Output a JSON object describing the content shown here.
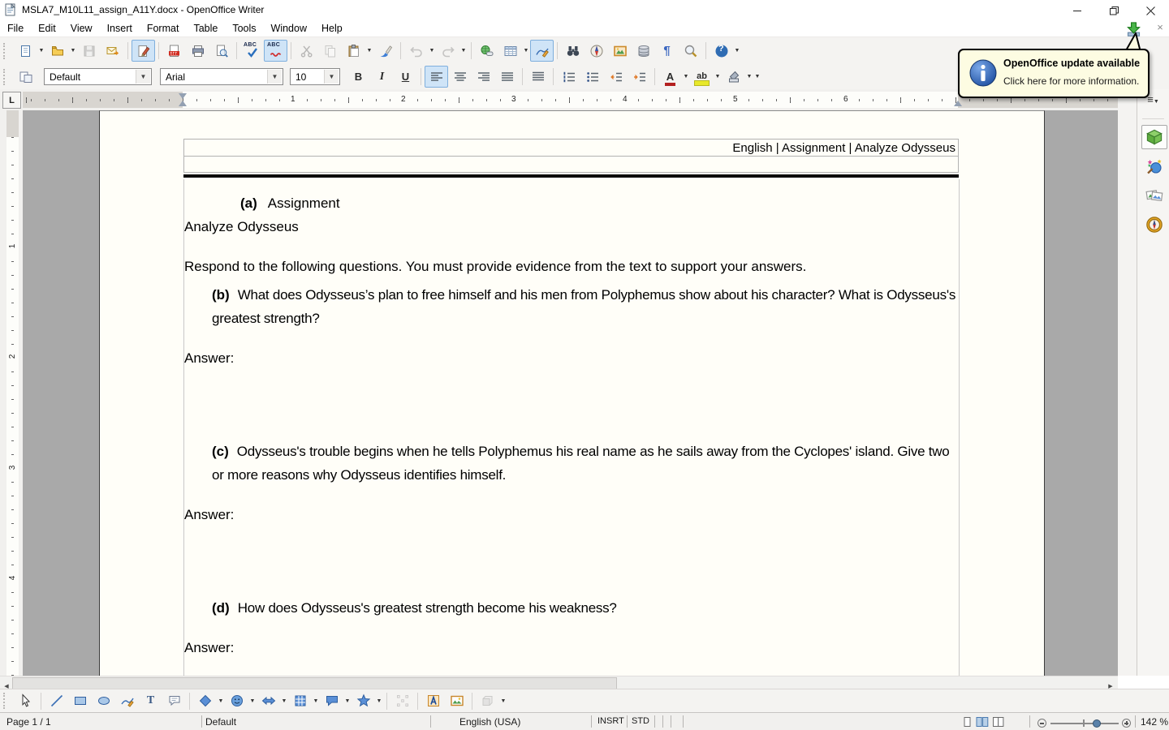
{
  "window": {
    "title": "MSLA7_M10L11_assign_A11Y.docx - OpenOffice Writer",
    "controls": [
      "minimize",
      "restore",
      "close"
    ]
  },
  "menu": [
    "File",
    "Edit",
    "View",
    "Insert",
    "Format",
    "Table",
    "Tools",
    "Window",
    "Help"
  ],
  "toolbar_standard": {
    "buttons": [
      "new-document",
      "open",
      "save",
      "email-document",
      "edit-file",
      "export-pdf",
      "print",
      "page-preview",
      "spellcheck",
      "auto-spellcheck",
      "cut",
      "copy",
      "paste",
      "format-paintbrush",
      "undo",
      "redo",
      "hyperlink",
      "insert-table",
      "show-draw-functions",
      "find-replace",
      "navigator",
      "gallery",
      "data-sources",
      "nonprinting-characters",
      "zoom",
      "help"
    ],
    "abc_label": "ABC",
    "pilcrow": "¶",
    "help_glyph": "?"
  },
  "toolbar_formatting": {
    "paragraph_style": "Default",
    "font_name": "Arial",
    "font_size": "10",
    "bold": "B",
    "italic": "I",
    "underline": "U",
    "font_color_glyph": "A",
    "highlight_glyph": "ab",
    "buttons": [
      "styles-and-formatting",
      "bold",
      "italic",
      "underline",
      "align-left",
      "align-center",
      "align-right",
      "justified",
      "line-spacing",
      "numbered-list",
      "bullet-list",
      "decrease-indent",
      "increase-indent",
      "font-color",
      "highlighting",
      "background-color"
    ]
  },
  "notification": {
    "title": "OpenOffice update available",
    "message": "Click here for more information."
  },
  "ruler": {
    "tab_type": "L",
    "h_numbers": [
      "1",
      "2",
      "3",
      "4",
      "5",
      "6"
    ],
    "v_numbers": [
      "1",
      "2",
      "3",
      "4"
    ]
  },
  "document": {
    "header_right": "English | Assignment | Analyze Odysseus",
    "a_label": "(a)",
    "a_text": "Assignment",
    "p_analyze": "Analyze Odysseus",
    "p_respond": "Respond to the following questions. You must provide evidence from the text to support your answers.",
    "b_label": "(b)",
    "b_text": "What does Odysseus’s plan to free himself and his men from Polyphemus show about his character? What is Odysseus's greatest strength?",
    "c_label": "(c)",
    "c_text": "Odysseus's trouble begins when he tells Polyphemus his real name as he sails away from the Cyclopes' island. Give two or more reasons why Odysseus identifies himself.",
    "d_label": "(d)",
    "d_text": "How does Odysseus's greatest strength become his weakness?",
    "answer": "Answer:"
  },
  "drawing_toolbar": {
    "buttons": [
      "select",
      "line",
      "rectangle",
      "ellipse",
      "freeform-line",
      "text",
      "callout-frame",
      "basic-shapes",
      "symbol-shapes",
      "block-arrows",
      "flowchart",
      "callouts",
      "stars",
      "points",
      "fontwork-gallery",
      "from-file",
      "extrusion"
    ],
    "text_glyph": "T"
  },
  "status_bar": {
    "page": "Page 1 / 1",
    "page_style": "Default",
    "language": "English (USA)",
    "insert_mode": "INSRT",
    "selection_mode": "STD",
    "zoom_level": "142 %"
  },
  "sidebar": {
    "items": [
      "sidebar-settings",
      "properties",
      "styles-and-formatting",
      "gallery",
      "navigator"
    ]
  }
}
